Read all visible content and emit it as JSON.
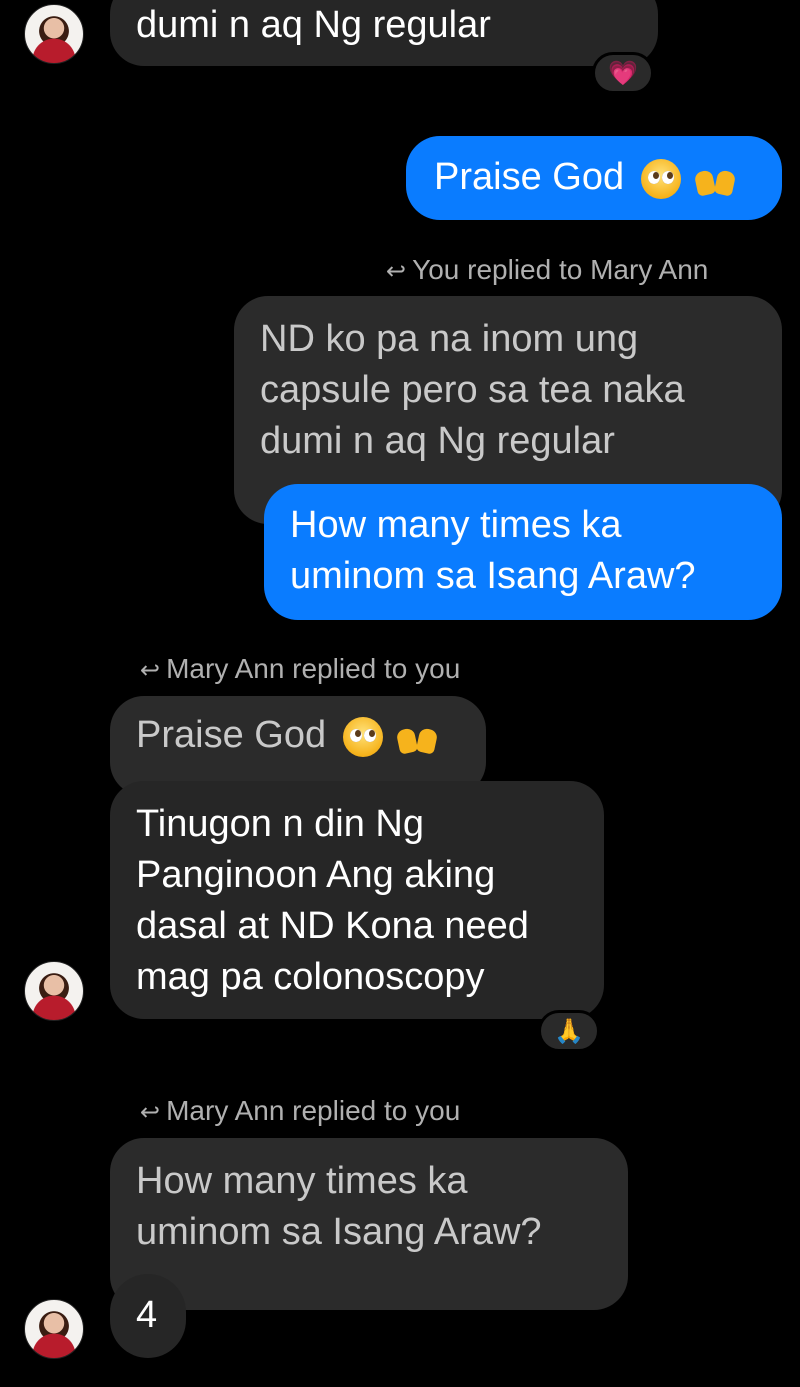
{
  "messages": {
    "m1_tail": "dumi n aq Ng regular",
    "m1_reaction": "💗",
    "m2_out": "Praise God",
    "m3_reply_label": "You replied to Mary Ann",
    "m3_quoted": "ND ko pa na inom ung capsule  pero sa tea naka dumi n aq Ng regular",
    "m3_out": "How many times ka uminom sa Isang Araw?",
    "m4_reply_label": "Mary Ann replied to you",
    "m4_quoted": "Praise God",
    "m4_in": "Tinugon n din Ng Panginoon Ang aking dasal at ND Kona need mag pa colonoscopy",
    "m4_reaction": "🙏",
    "m5_reply_label": "Mary Ann replied to you",
    "m5_quoted": "How many times ka uminom sa Isang Araw?",
    "m5_in": "4"
  },
  "icons": {
    "reply_arrow": "reply-arrow-icon",
    "emoji_pleading": "pleading-face-icon",
    "emoji_raised_hands": "raised-hands-icon"
  },
  "colors": {
    "background": "#000000",
    "incoming_bubble": "#262626",
    "outgoing_bubble": "#0a7cff",
    "reply_label": "#b0b0b0"
  }
}
